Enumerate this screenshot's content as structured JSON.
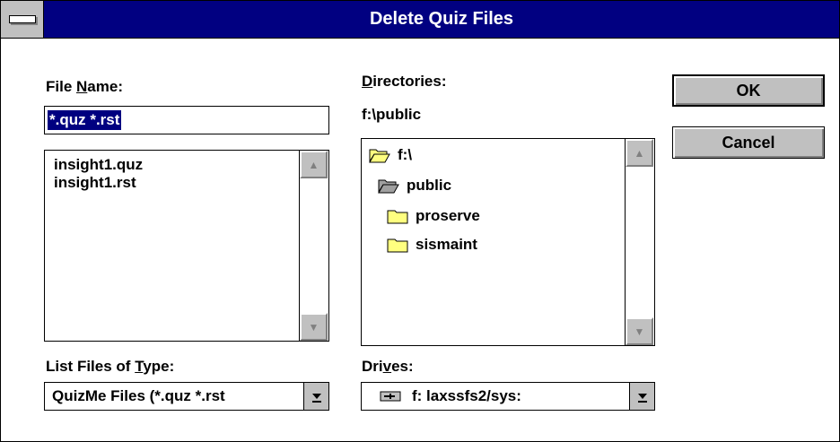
{
  "window": {
    "title": "Delete Quiz Files"
  },
  "file_name": {
    "label_pre": "File ",
    "label_key": "N",
    "label_post": "ame:",
    "value": "*.quz *.rst"
  },
  "files": [
    "insight1.quz",
    "insight1.rst"
  ],
  "directories": {
    "label_key": "D",
    "label_post": "irectories:",
    "current_path": "f:\\public",
    "items": [
      {
        "name": "f:\\",
        "icon": "open-folder-icon"
      },
      {
        "name": "public",
        "icon": "open-folder-icon"
      },
      {
        "name": "proserve",
        "icon": "folder-icon"
      },
      {
        "name": "sismaint",
        "icon": "folder-icon"
      }
    ]
  },
  "file_type": {
    "label_pre": "List Files of ",
    "label_key": "T",
    "label_post": "ype:",
    "value": "QuizMe Files (*.quz *.rst"
  },
  "drives": {
    "label_pre": "Dri",
    "label_key": "v",
    "label_post": "es:",
    "value": "f: laxssfs2/sys:",
    "icon": "network-drive-icon"
  },
  "buttons": {
    "ok": "OK",
    "cancel": "Cancel"
  },
  "colors": {
    "titlebar": "#010081",
    "selection": "#000080",
    "button_face": "#c0c0c0"
  }
}
